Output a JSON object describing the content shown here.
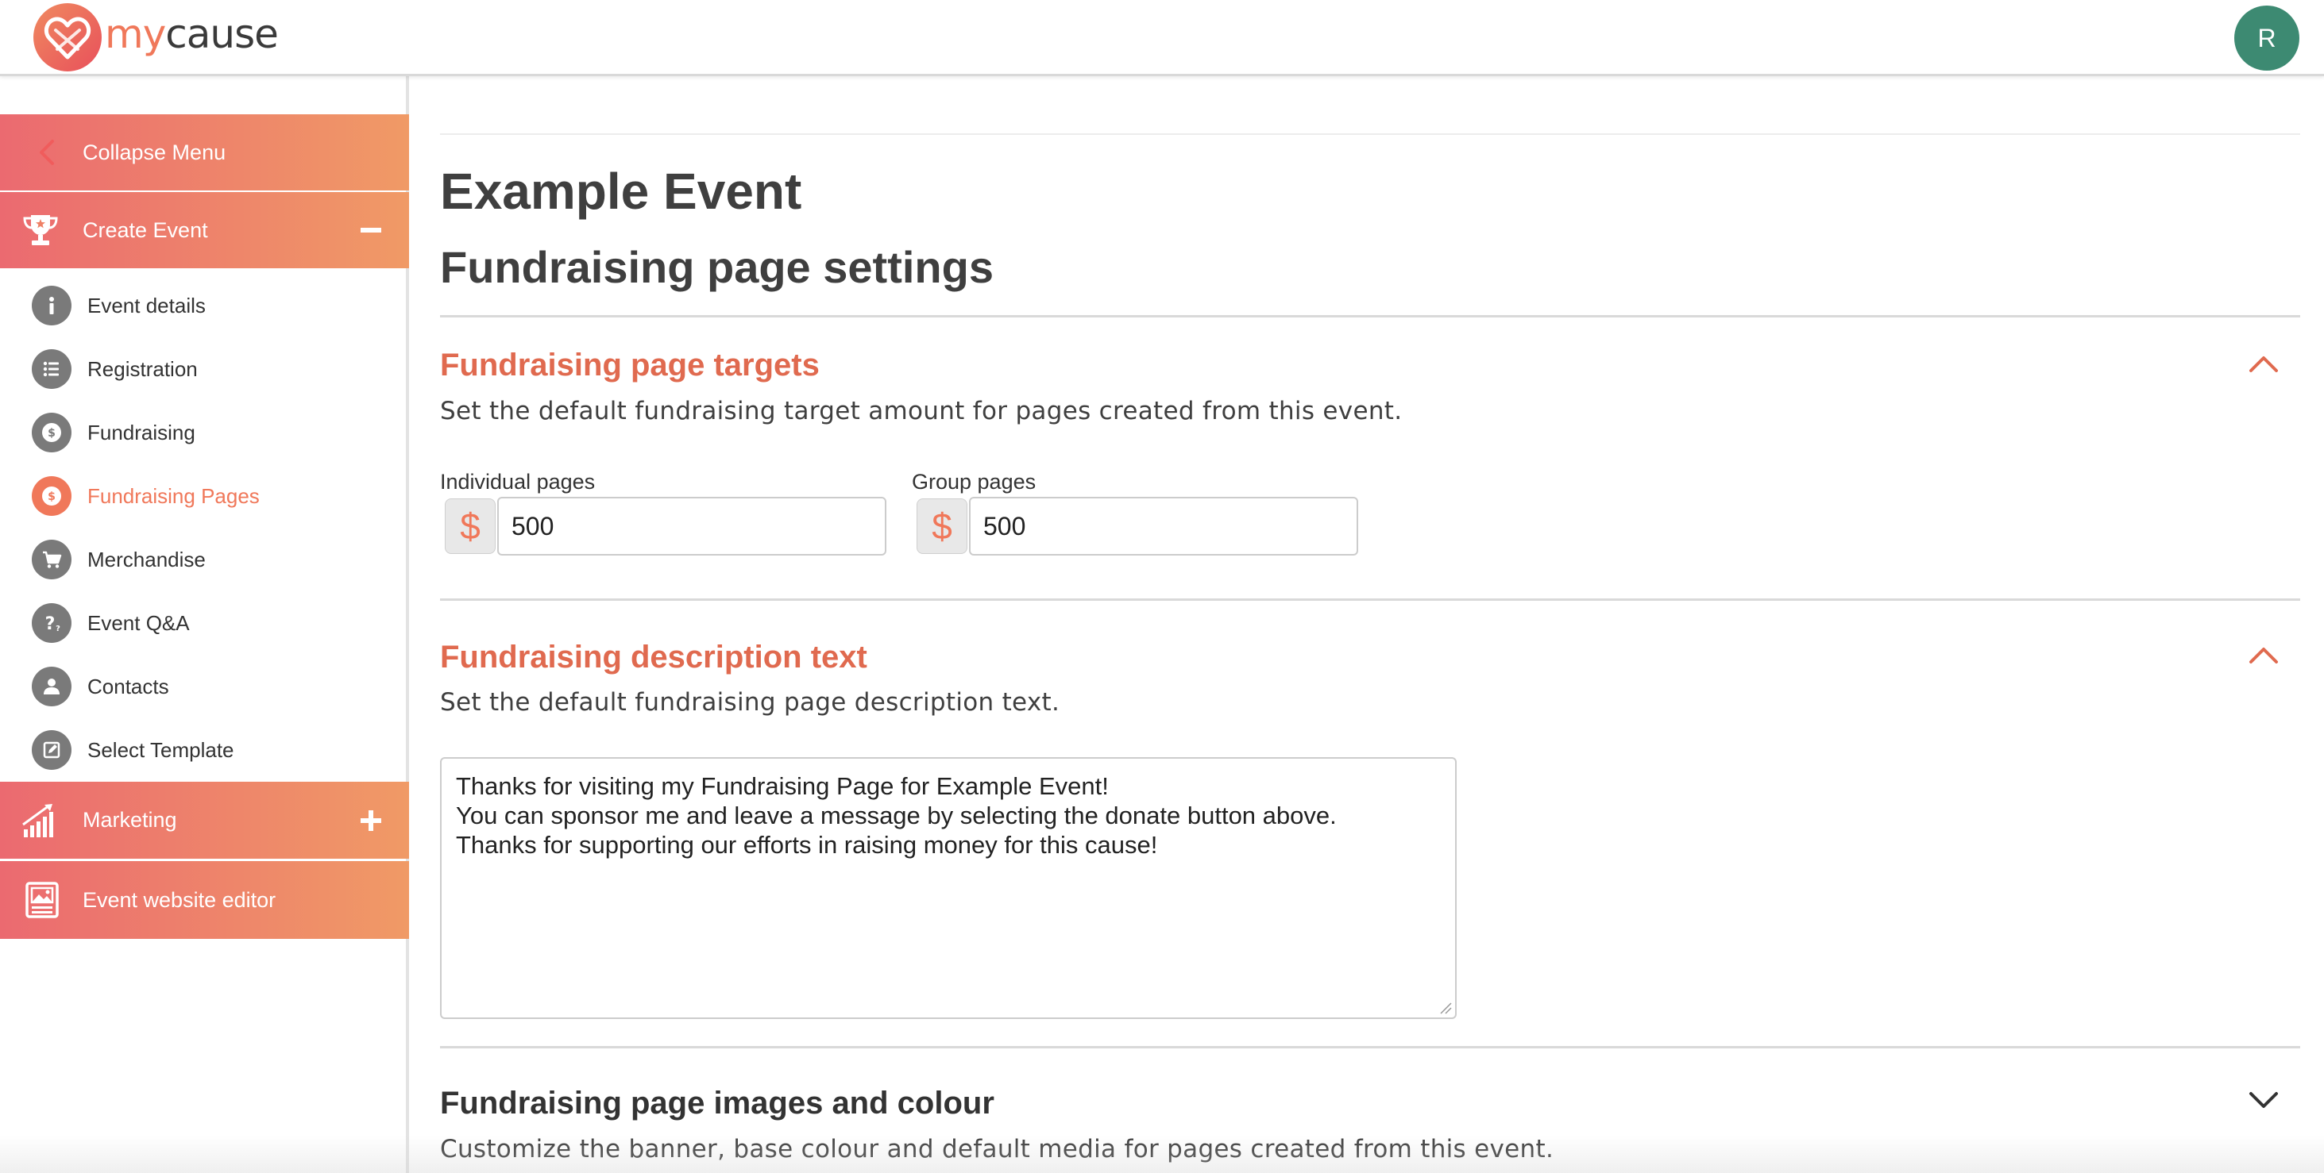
{
  "header": {
    "logo_my": "my",
    "logo_cause": "cause",
    "avatar_initial": "R"
  },
  "sidebar": {
    "collapse_label": "Collapse Menu",
    "create_event_label": "Create Event",
    "items": [
      {
        "label": "Event details",
        "icon": "info-icon"
      },
      {
        "label": "Registration",
        "icon": "list-icon"
      },
      {
        "label": "Fundraising",
        "icon": "dollar-coin-icon"
      },
      {
        "label": "Fundraising Pages",
        "icon": "dollar-coin-icon",
        "active": true
      },
      {
        "label": "Merchandise",
        "icon": "cart-icon"
      },
      {
        "label": "Event Q&A",
        "icon": "question-icon"
      },
      {
        "label": "Contacts",
        "icon": "person-icon"
      },
      {
        "label": "Select Template",
        "icon": "edit-icon"
      }
    ],
    "marketing_label": "Marketing",
    "website_editor_label": "Event website editor"
  },
  "main": {
    "event_title": "Example Event",
    "page_title": "Fundraising page settings",
    "targets": {
      "title": "Fundraising page targets",
      "description": "Set the default fundraising target amount for pages created from this event.",
      "individual_label": "Individual pages",
      "individual_value": "500",
      "group_label": "Group pages",
      "group_value": "500",
      "currency_symbol": "$"
    },
    "description_section": {
      "title": "Fundraising description text",
      "description": "Set the default fundraising page description text.",
      "text_lines": [
        "Thanks for visiting my Fundraising Page for Example Event!",
        "You can sponsor me and leave a message by selecting the donate button above.",
        "Thanks for supporting our efforts in raising money for this cause!"
      ]
    },
    "images_section": {
      "title": "Fundraising page images and colour",
      "description": "Customize the banner, base colour and default media for pages created from this event."
    }
  },
  "colors": {
    "accent": "#f0785a",
    "section_title": "#e06a4f",
    "gradient_start": "#eb6a70",
    "gradient_end": "#f09a66",
    "avatar": "#3d8a72"
  }
}
